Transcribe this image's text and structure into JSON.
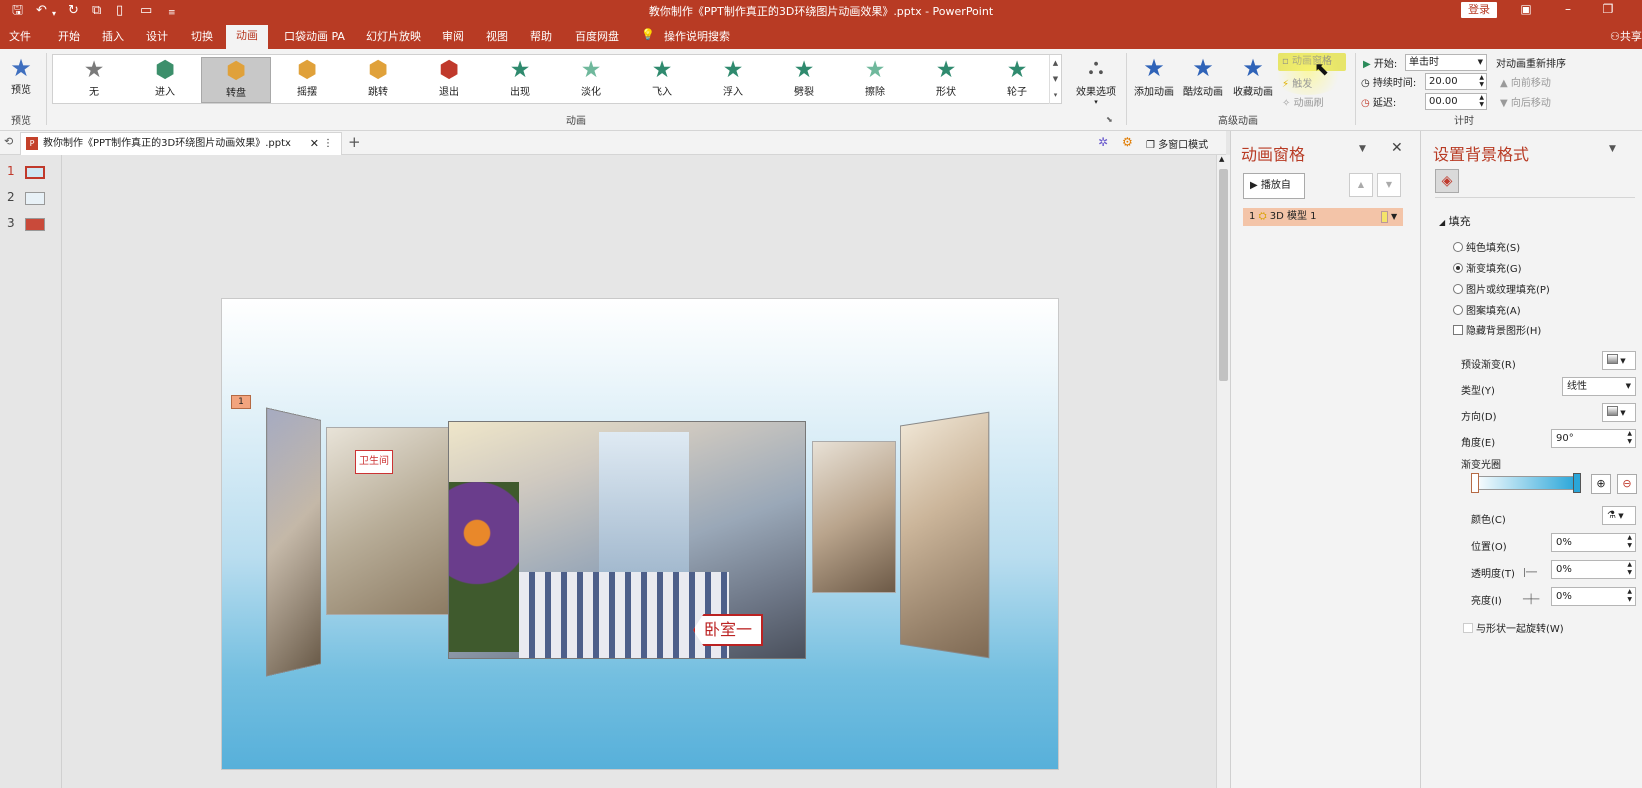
{
  "window": {
    "title": "教你制作《PPT制作真正的3D环绕图片动画效果》.pptx  -  PowerPoint",
    "login": "登录"
  },
  "menu": {
    "tabs": [
      "文件",
      "开始",
      "插入",
      "设计",
      "切换",
      "动画",
      "口袋动画 PA",
      "幻灯片放映",
      "审阅",
      "视图",
      "帮助",
      "百度网盘"
    ],
    "active": "动画",
    "tell_me": "操作说明搜索",
    "share": "共享"
  },
  "ribbon": {
    "preview": {
      "label": "预览",
      "group": "预览"
    },
    "effects": [
      {
        "label": "无",
        "icon": "star-gray-icon",
        "color": "#7a7a7a"
      },
      {
        "label": "进入",
        "icon": "cube-enter-icon",
        "color": "#3c8f6b"
      },
      {
        "label": "转盘",
        "icon": "cube-turntable-icon",
        "color": "#e0a13a",
        "selected": true
      },
      {
        "label": "摇摆",
        "icon": "cube-swing-icon",
        "color": "#e0a13a"
      },
      {
        "label": "跳转",
        "icon": "cube-jump-icon",
        "color": "#e0a13a"
      },
      {
        "label": "退出",
        "icon": "cube-exit-icon",
        "color": "#c0392b"
      },
      {
        "label": "出现",
        "icon": "star-appear-icon",
        "color": "#2f8a6e"
      },
      {
        "label": "淡化",
        "icon": "star-fade-icon",
        "color": "#6fb89c"
      },
      {
        "label": "飞入",
        "icon": "star-fly-icon",
        "color": "#2f8a6e"
      },
      {
        "label": "浮入",
        "icon": "star-float-icon",
        "color": "#2f8a6e"
      },
      {
        "label": "劈裂",
        "icon": "star-split-icon",
        "color": "#2f8a6e"
      },
      {
        "label": "擦除",
        "icon": "star-wipe-icon",
        "color": "#6fb89c"
      },
      {
        "label": "形状",
        "icon": "star-shape-icon",
        "color": "#2f8a6e"
      },
      {
        "label": "轮子",
        "icon": "star-wheel-icon",
        "color": "#2f8a6e"
      }
    ],
    "effect_options": "效果选项",
    "group_animation": "动画",
    "add_animation": "添加动画",
    "custom_animation": "酷炫动画",
    "favorite_animation": "收藏动画",
    "animation_pane": "动画窗格",
    "trigger": "触发",
    "painter": "动画刷",
    "group_advanced": "高级动画",
    "start_label": "开始:",
    "start_value": "单击时",
    "duration_label": "持续时间:",
    "duration_value": "20.00",
    "delay_label": "延迟:",
    "delay_value": "00.00",
    "reorder": "对动画重新排序",
    "move_earlier": "向前移动",
    "move_later": "向后移动",
    "group_timing": "计时"
  },
  "document": {
    "tab": "教你制作《PPT制作真正的3D环绕图片动画效果》.pptx",
    "multi_window": "多窗口模式"
  },
  "slides": [
    {
      "n": "1"
    },
    {
      "n": "2"
    },
    {
      "n": "3"
    }
  ],
  "slide": {
    "anim_tag": "1",
    "bedroom_label": "卧室一",
    "bathroom_label": "卫生间"
  },
  "anim_pane": {
    "title": "动画窗格",
    "play_from": "播放自",
    "item_index": "1",
    "item_label": "3D 模型 1"
  },
  "bg_pane": {
    "title": "设置背景格式",
    "section": "填充",
    "fill_options": [
      {
        "label": "纯色填充(S)",
        "checked": false
      },
      {
        "label": "渐变填充(G)",
        "checked": true
      },
      {
        "label": "图片或纹理填充(P)",
        "checked": false
      },
      {
        "label": "图案填充(A)",
        "checked": false
      }
    ],
    "hide_bg": "隐藏背景图形(H)",
    "preset": "预设渐变(R)",
    "type_label": "类型(Y)",
    "type_value": "线性",
    "direction": "方向(D)",
    "angle_label": "角度(E)",
    "angle_value": "90°",
    "stops_label": "渐变光圈",
    "color_label": "颜色(C)",
    "position_label": "位置(O)",
    "position_value": "0%",
    "transparency_label": "透明度(T)",
    "transparency_value": "0%",
    "brightness_label": "亮度(I)",
    "brightness_value": "0%",
    "rotate": "与形状一起旋转(W)"
  }
}
